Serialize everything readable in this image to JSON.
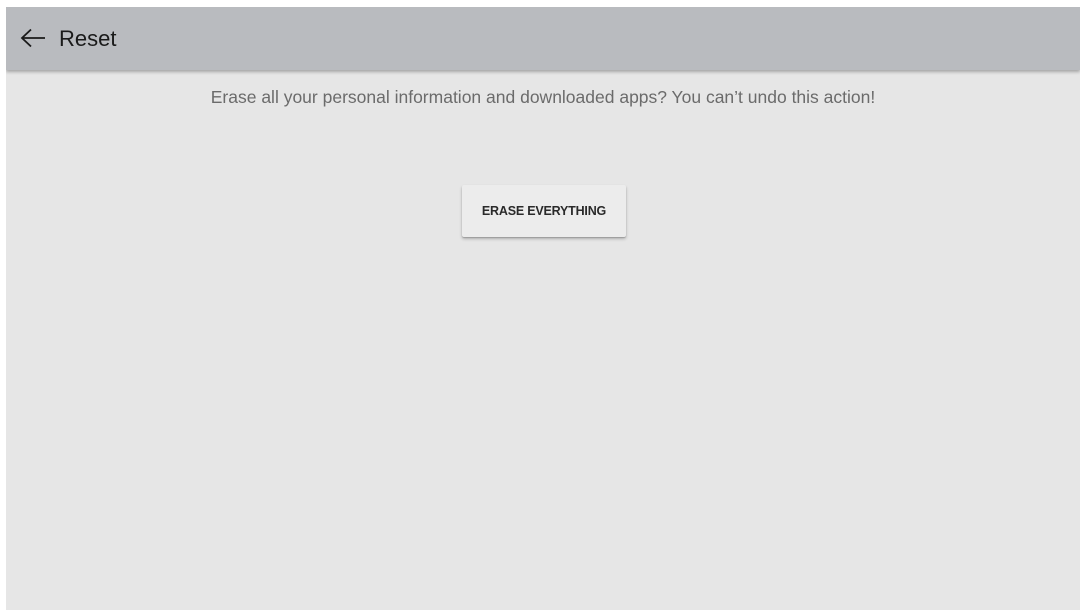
{
  "appbar": {
    "back_icon": "arrow-left-icon",
    "title": "Reset"
  },
  "main": {
    "message": "Erase all your personal information and downloaded apps? You can’t undo this action!",
    "erase_button_label": "ERASE EVERYTHING"
  },
  "colors": {
    "appbar_background": "#b9bbbf",
    "content_background": "#e6e6e6",
    "button_background": "#ececec",
    "message_text": "#6b6b6b"
  }
}
